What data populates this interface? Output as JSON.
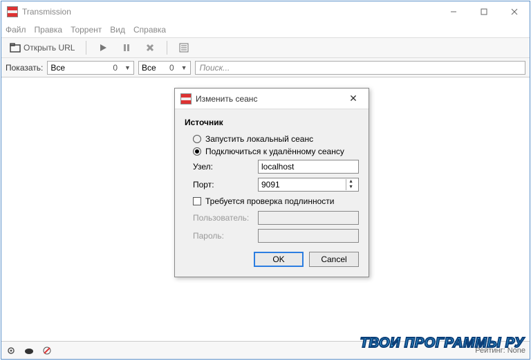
{
  "window": {
    "title": "Transmission"
  },
  "menu": {
    "file": "Файл",
    "edit": "Правка",
    "torrent": "Торрент",
    "view": "Вид",
    "help": "Справка"
  },
  "toolbar": {
    "open_url": "Открыть URL"
  },
  "filter": {
    "show_label": "Показать:",
    "combo1_value": "Все",
    "combo1_count": "0",
    "combo2_value": "Все",
    "combo2_count": "0",
    "search_placeholder": "Поиск..."
  },
  "statusbar": {
    "rating": "Рейтинг: None"
  },
  "dialog": {
    "title": "Изменить сеанс",
    "section": "Источник",
    "radio_local": "Запустить локальный сеанс",
    "radio_remote": "Подключиться к удалённому сеансу",
    "host_label": "Узел:",
    "host_value": "localhost",
    "port_label": "Порт:",
    "port_value": "9091",
    "auth_label": "Требуется проверка подлинности",
    "user_label": "Пользователь:",
    "user_value": "",
    "pass_label": "Пароль:",
    "pass_value": "",
    "ok": "OK",
    "cancel": "Cancel"
  },
  "watermark": "ТВОИ ПРОГРАММЫ РУ"
}
